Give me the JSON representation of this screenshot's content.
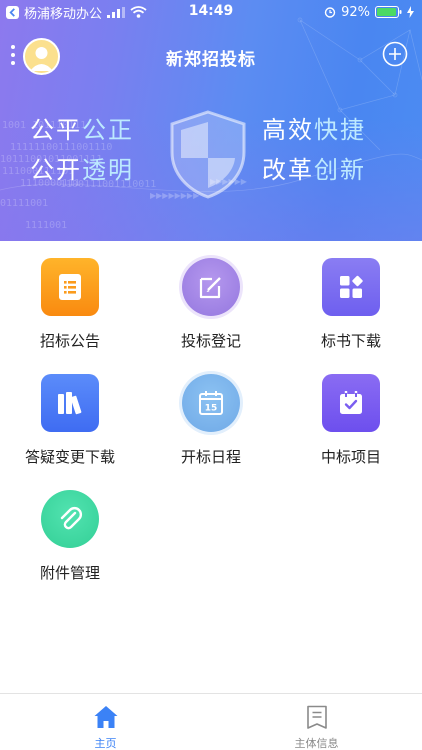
{
  "status_bar": {
    "carrier": "杨浦移动办公",
    "time": "14:49",
    "battery": "92%"
  },
  "header": {
    "title": "新郑招投标"
  },
  "banner": {
    "line1_left_a": "公平",
    "line1_left_b": "公正",
    "line2_left_a": "公开",
    "line2_left_b": "透明",
    "line1_right_a": "高效",
    "line1_right_b": "快捷",
    "line2_right_a": "改革",
    "line2_right_b": "创新",
    "background_binary": [
      "1001 101110111",
      "11111100111001110",
      "10111001011001111",
      "111000111101",
      "1110000111",
      "1100111001110011",
      "01111001",
      "1111001"
    ]
  },
  "menu": [
    {
      "label": "招标公告",
      "icon": "bulletin-icon",
      "color": "#fb9b1c"
    },
    {
      "label": "投标登记",
      "icon": "edit-icon",
      "color": "#9d7ee3"
    },
    {
      "label": "标书下载",
      "icon": "grid-apps-icon",
      "color": "#7a6ff0"
    },
    {
      "label": "答疑变更下载",
      "icon": "books-icon",
      "color": "#4f7bf7"
    },
    {
      "label": "开标日程",
      "icon": "calendar-icon",
      "color": "#78b4ec"
    },
    {
      "label": "中标项目",
      "icon": "calendar-check-icon",
      "color": "#7a5ef0"
    },
    {
      "label": "附件管理",
      "icon": "paperclip-icon",
      "color": "#3fd6a0"
    }
  ],
  "tabs": {
    "home": "主页",
    "entity": "主体信息"
  },
  "colors": {
    "accent": "#3b82f6",
    "tab_inactive": "#8a8a8a"
  }
}
